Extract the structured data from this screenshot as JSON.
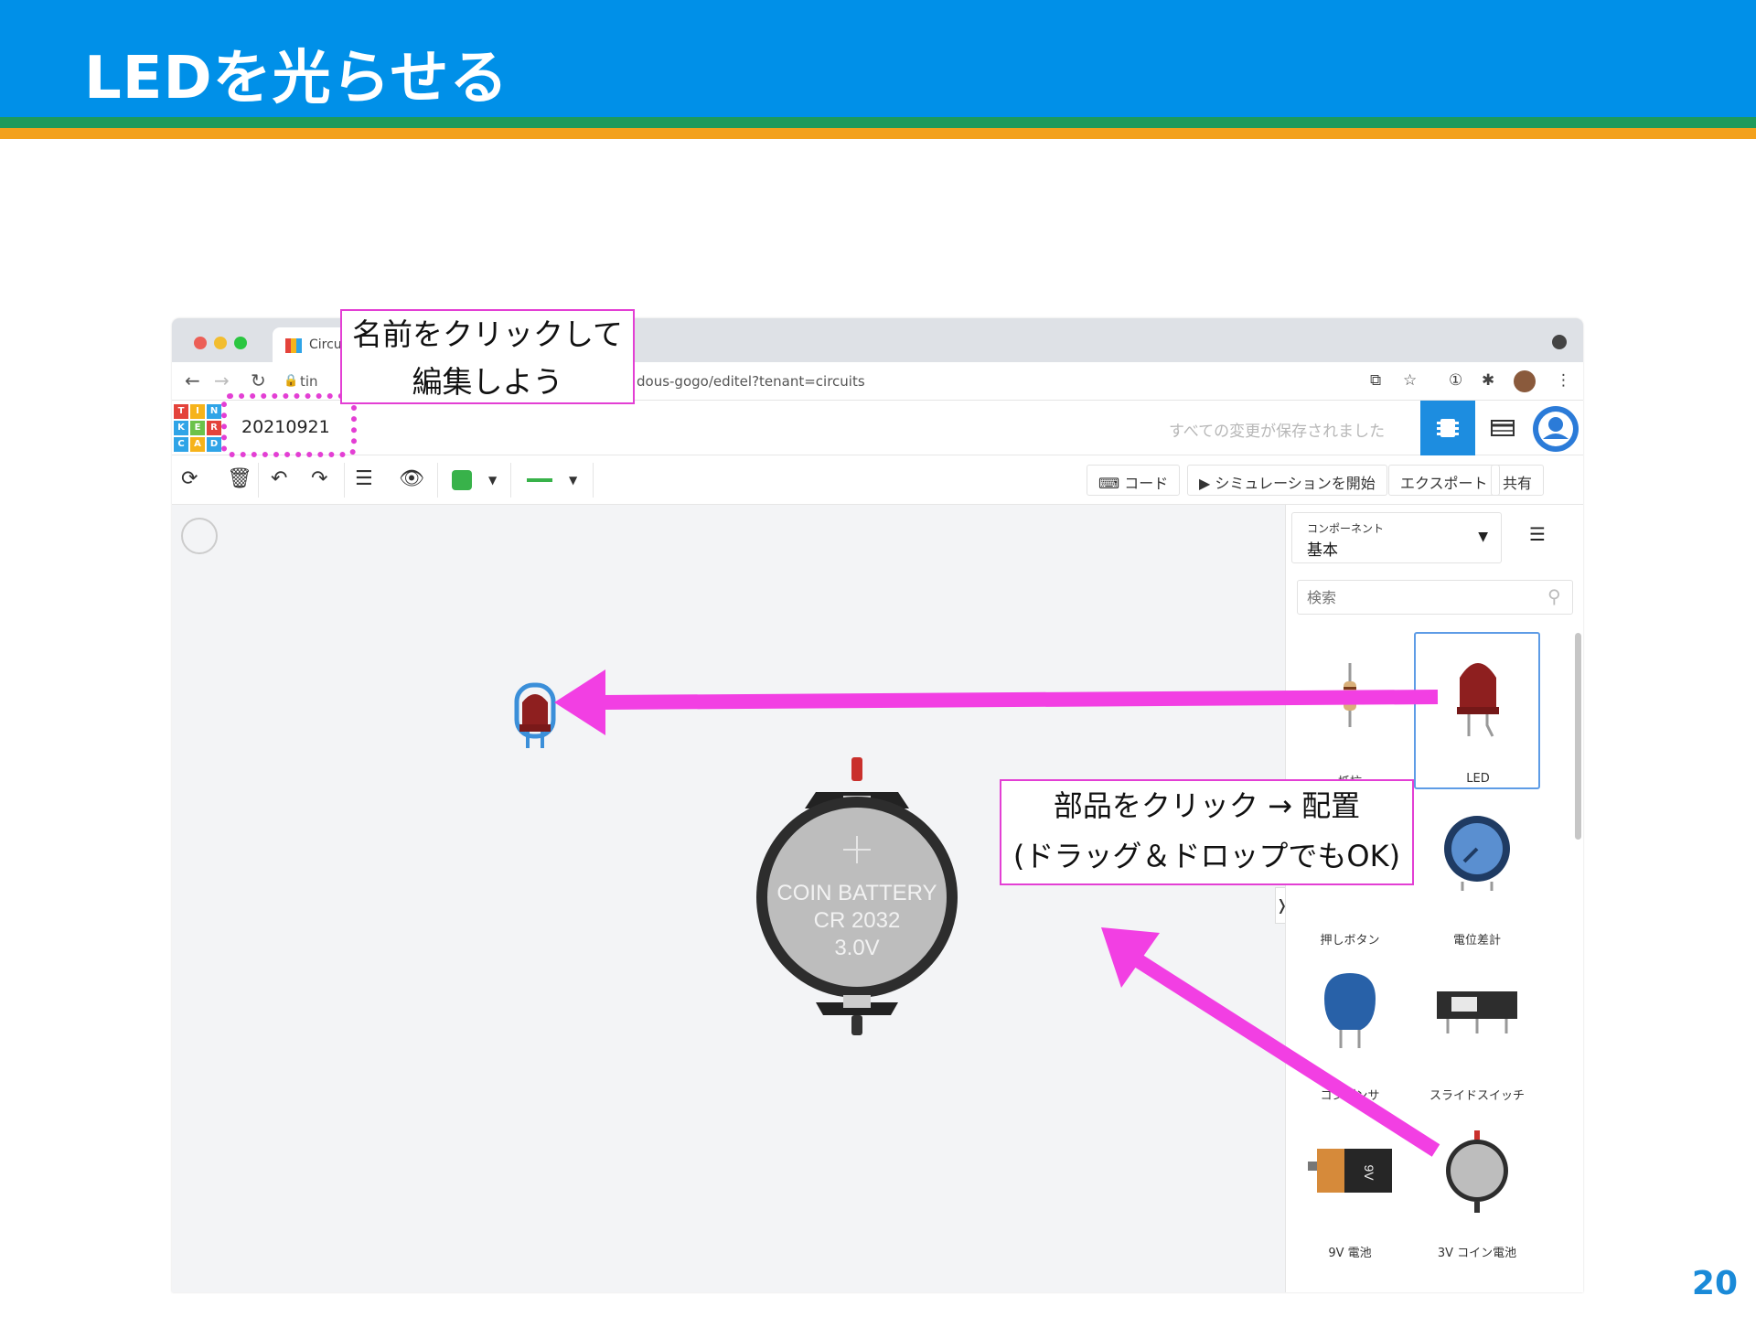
{
  "slide": {
    "title": "LEDを光らせる",
    "page_number": "20",
    "colors": {
      "header_blue": "#0090e8",
      "stripe_green": "#1f9a5b",
      "stripe_orange": "#f3a11c",
      "callout_magenta": "#e33fd4"
    }
  },
  "browser": {
    "tab_title": "Circu",
    "url": "dous-gogo/editel?tenant=circuits",
    "url_prefix": "tin"
  },
  "app": {
    "design_name": "20210921",
    "saved_status": "すべての変更が保存されました",
    "logo_letters": [
      "T",
      "I",
      "N",
      "K",
      "E",
      "R",
      "C",
      "A",
      "D"
    ],
    "toolbar": {
      "code_label": "コード",
      "start_sim_label": "シミュレーションを開始",
      "export_label": "エクスポート",
      "share_label": "共有"
    },
    "panel": {
      "components_small": "コンポーネント",
      "components_value": "基本",
      "search_placeholder": "検索",
      "items": [
        {
          "label": "抵抗"
        },
        {
          "label": "LED"
        },
        {
          "label": "押しボタン"
        },
        {
          "label": "電位差計"
        },
        {
          "label": "コンデンサ"
        },
        {
          "label": "スライドスイッチ"
        },
        {
          "label": "9V 電池"
        },
        {
          "label": "3V コイン電池"
        }
      ]
    },
    "battery": {
      "line1": "COIN BATTERY",
      "line2": "CR 2032",
      "line3": "3.0V"
    },
    "nine_volt_text": "9V"
  },
  "callouts": {
    "rename_line1": "名前をクリックして",
    "rename_line2": "編集しよう",
    "place_line1": "部品をクリック → 配置",
    "place_line2": "(ドラッグ＆ドロップでもOK)"
  }
}
